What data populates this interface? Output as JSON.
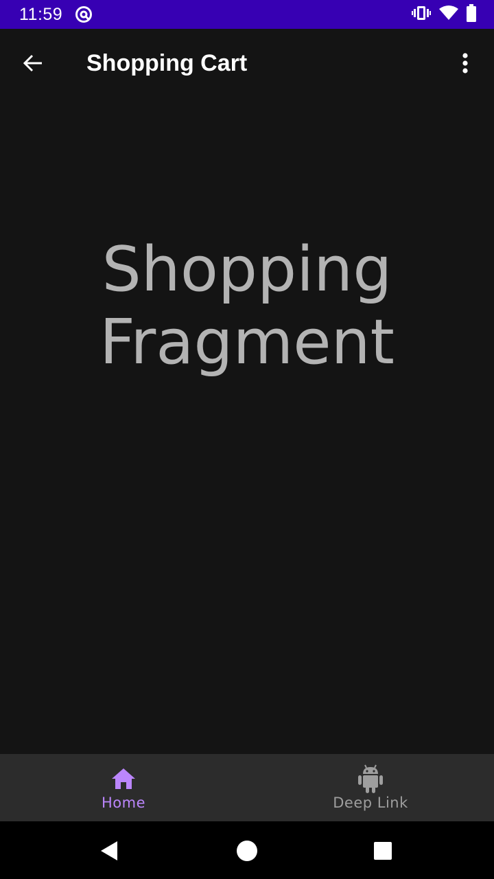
{
  "status_bar": {
    "time": "11:59",
    "background": "#3700b3",
    "icons": [
      "app-notification-icon",
      "vibrate-icon",
      "wifi-icon",
      "battery-icon"
    ]
  },
  "app_bar": {
    "title": "Shopping Cart",
    "back_icon": "arrow-back-icon",
    "overflow_icon": "more-vert-icon"
  },
  "content": {
    "line1": "Shopping",
    "line2": "Fragment"
  },
  "bottom_nav": {
    "items": [
      {
        "label": "Home",
        "icon": "home-icon",
        "selected": true
      },
      {
        "label": "Deep Link",
        "icon": "android-icon",
        "selected": false
      }
    ],
    "accent": "#bb86fc"
  },
  "system_nav": {
    "icons": [
      "back-triangle-icon",
      "home-circle-icon",
      "recents-square-icon"
    ]
  }
}
